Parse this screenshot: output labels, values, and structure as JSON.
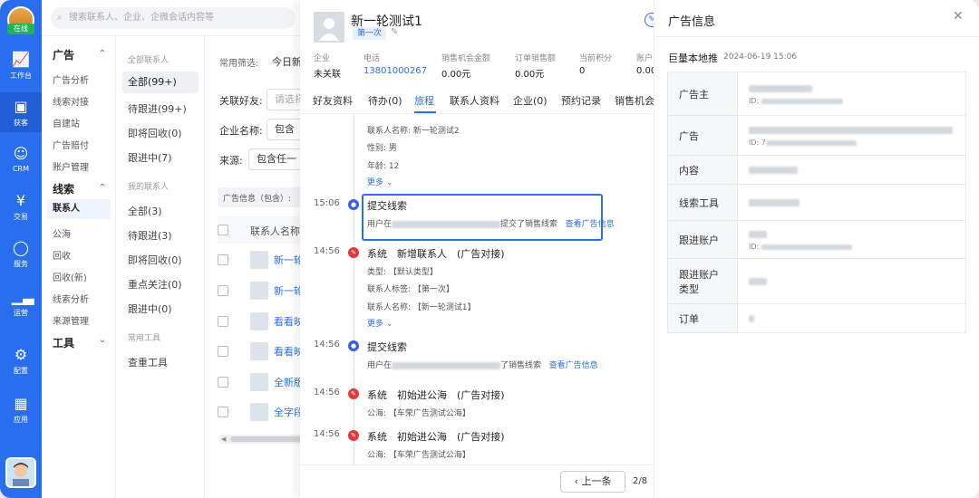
{
  "rail": {
    "status": "在线",
    "items": [
      {
        "label": "工作台",
        "icon": "workbench-icon"
      },
      {
        "label": "获客",
        "icon": "acquire-icon"
      },
      {
        "label": "CRM",
        "icon": "person-icon"
      },
      {
        "label": "交易",
        "icon": "yen-icon"
      },
      {
        "label": "服务",
        "icon": "chat-icon"
      },
      {
        "label": "运营",
        "icon": "chart-icon"
      },
      {
        "label": "配置",
        "icon": "gear-icon"
      },
      {
        "label": "应用",
        "icon": "apps-icon"
      }
    ],
    "accent": "#2a6ef0"
  },
  "search": {
    "placeholder": "搜索联系人、企业、企微会话内容等"
  },
  "nav2": {
    "group1": "广告",
    "group1_items": [
      "广告分析",
      "线索对接",
      "自建站",
      "广告赔付",
      "账户管理"
    ],
    "group2": "线索",
    "group2_items": [
      "联系人",
      "公海",
      "回收",
      "回收(新)",
      "线索分析",
      "来源管理"
    ],
    "group3": "工具"
  },
  "col3": {
    "h1": "全部联系人",
    "items1": [
      "全部(99+)",
      "待跟进(99+)",
      "即将回收(0)",
      "跟进中(7)"
    ],
    "h2": "我的联系人",
    "items2": [
      "全部(3)",
      "待跟进(3)",
      "即将回收(0)",
      "重点关注(0)",
      "跟进中(0)"
    ],
    "h3": "常用工具",
    "items3": [
      "查重工具"
    ]
  },
  "list": {
    "filter_label": "常用筛选:",
    "filter_value": "今日新",
    "friend_label": "关联好友:",
    "friend_placeholder": "请选择",
    "company_label": "企业名称:",
    "company_value": "包含",
    "source_label": "来源:",
    "source_value": "包含任一",
    "info_chip": "广告信息（包含）:",
    "col_header": "联系人名称",
    "rows": [
      "新一轮",
      "新一轮",
      "看看映",
      "看看映",
      "全新版",
      "全字段"
    ]
  },
  "detail": {
    "name": "新一轮测试1",
    "tag": "第一次",
    "stats": [
      {
        "label": "企业",
        "value": "未关联"
      },
      {
        "label": "电话",
        "value": "13801000267"
      },
      {
        "label": "销售机会金额",
        "value": "0.00元"
      },
      {
        "label": "订单销售额",
        "value": "0.00元"
      },
      {
        "label": "当前积分",
        "value": "0"
      },
      {
        "label": "账户",
        "value": "0.00"
      }
    ],
    "tabs": [
      "好友资料",
      "待办(0)",
      "旅程",
      "联系人资料",
      "企业(0)",
      "预约记录",
      "销售机会"
    ],
    "timeline": {
      "top_lines": [
        "联系人名称: 新一轮测试2",
        "性别: 男",
        "年龄: 12"
      ],
      "more": "更多",
      "e1_time": "15:06",
      "e1_title": "提交线索",
      "e1_sub_a": "用户在",
      "e1_sub_b": "提交了销售线索",
      "e1_link": "查看广告信息",
      "e2_time": "14:56",
      "e2_title": "系统　新增联系人　(广告对接)",
      "e2_lines": [
        "类型: 【默认类型】",
        "联系人标签: 【第一次】",
        "联系人名称: 【新一轮测试1】"
      ],
      "e3_time": "14:56",
      "e3_title": "提交线索",
      "e3_sub_a": "用户在",
      "e3_sub_b": "了销售线索",
      "e3_link": "查看广告信息",
      "e4_time": "14:56",
      "e4_title": "系统　初始进公海　(广告对接)",
      "e4_line": "公海: 【车荣广告测试公海】",
      "e5_time": "14:56",
      "e5_title": "系统　初始进公海　(广告对接)",
      "e5_line": "公海: 【车荣广告测试公海】"
    },
    "prev_label": "上一条",
    "page": "2/8"
  },
  "ad_panel": {
    "title": "广告信息",
    "source": "巨量本地推",
    "datetime": "2024-06-19 15:06",
    "rows": [
      {
        "key": "广告主",
        "id_prefix": "ID:"
      },
      {
        "key": "广告",
        "id_prefix": "ID: 7"
      },
      {
        "key": "内容"
      },
      {
        "key": "线索工具"
      },
      {
        "key": "跟进账户",
        "id_prefix": "ID:"
      },
      {
        "key": "跟进账户类型"
      },
      {
        "key": "订单"
      }
    ]
  }
}
